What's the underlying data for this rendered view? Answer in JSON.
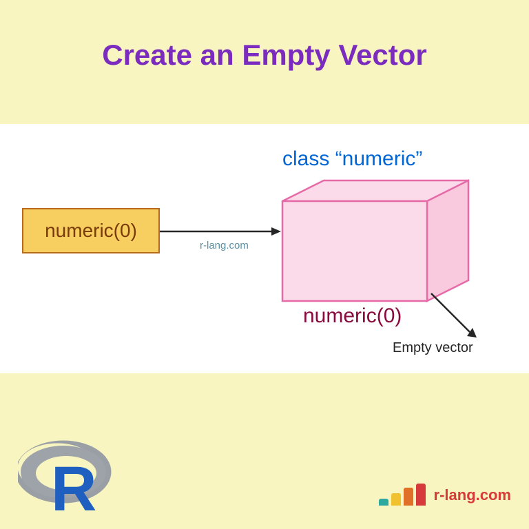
{
  "title": "Create an Empty Vector",
  "diagram": {
    "input_box": "numeric(0)",
    "watermark": "r-lang.com",
    "class_label": "class “numeric”",
    "output_label": "numeric(0)",
    "empty_label": "Empty vector"
  },
  "footer": {
    "brand": "r-lang.com"
  }
}
